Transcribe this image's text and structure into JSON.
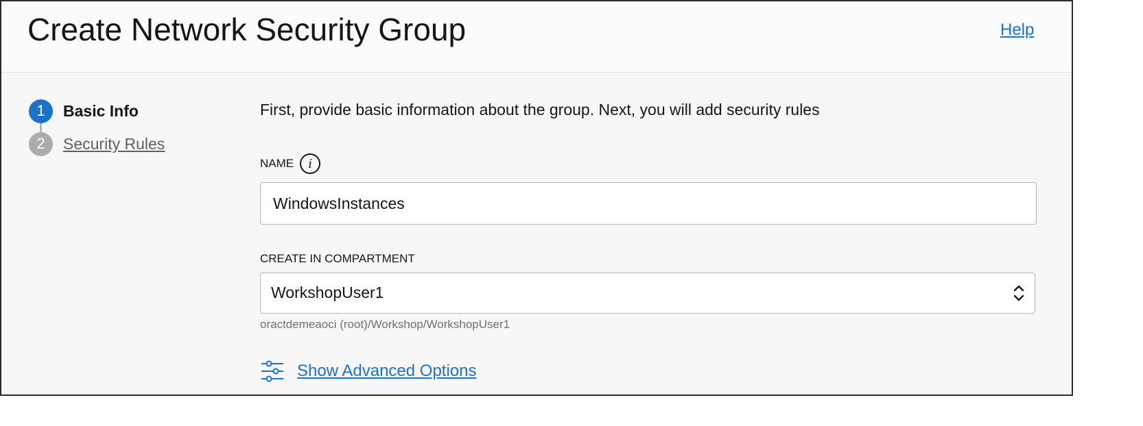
{
  "header": {
    "title": "Create Network Security Group",
    "help_label": "Help"
  },
  "steps": [
    {
      "number": "1",
      "label": "Basic Info",
      "state": "active",
      "color": "#1a72c9"
    },
    {
      "number": "2",
      "label": "Security Rules",
      "state": "pending",
      "color": "#ababab"
    }
  ],
  "form": {
    "intro": "First, provide basic information about the group. Next, you will add security rules",
    "name": {
      "label": "NAME",
      "info_glyph": "i",
      "value": "WindowsInstances"
    },
    "compartment": {
      "label": "CREATE IN COMPARTMENT",
      "value": "WorkshopUser1",
      "path": "oractdemeaoci (root)/Workshop/WorkshopUser1"
    },
    "advanced": {
      "icon": "sliders-icon",
      "label": "Show Advanced Options"
    }
  },
  "colors": {
    "accent": "#1a72c9",
    "step_inactive": "#ababab"
  }
}
